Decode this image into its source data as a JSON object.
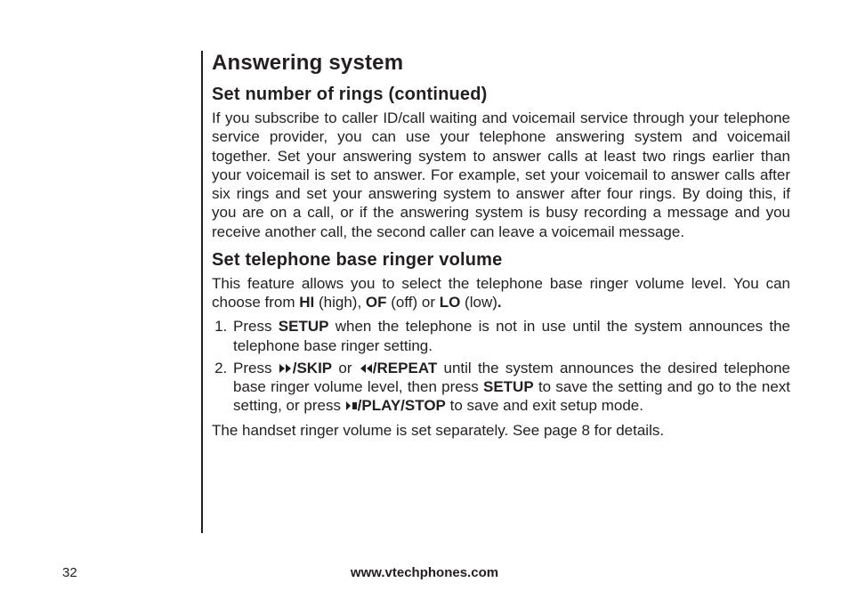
{
  "title": "Answering system",
  "section1": {
    "heading": "Set number of rings (continued)",
    "paragraph": "If you subscribe to caller ID/call waiting and voicemail service through your telephone service provider, you can use your telephone answering system and voicemail together. Set your answering system to answer calls at least two rings earlier than your voicemail is set to answer. For example, set your voicemail to answer calls after six rings and set your answering system to answer after four rings. By doing this, if you are on a call, or if the answering system is busy recording a message and you receive another call, the second caller can leave a voicemail message."
  },
  "section2": {
    "heading": "Set telephone base ringer volume",
    "intro_a": "This feature allows you to select the telephone base ringer volume level. You can choose from ",
    "hi": "HI",
    "intro_b": " (high), ",
    "of": "OF",
    "intro_c": " (off) or ",
    "lo": "LO",
    "intro_d": " (low)",
    "period": ".",
    "step1_a": "Press ",
    "setup": "SETUP",
    "step1_b": " when the telephone is not in use until the system announces the telephone base ringer setting.",
    "step2_a": "Press ",
    "skip": "/SKIP",
    "step2_b": " or ",
    "repeat": "REPEAT",
    "step2_c": " until the system announces the desired telephone base ringer volume level, then press ",
    "step2_d": " to save the setting and go to the next setting, or press ",
    "playstop": "PLAY/STOP",
    "step2_e": " to save and exit setup mode.",
    "final": "The handset ringer volume is set separately. See page 8 for details."
  },
  "footer": {
    "url": "www.vtechphones.com",
    "page": "32"
  }
}
